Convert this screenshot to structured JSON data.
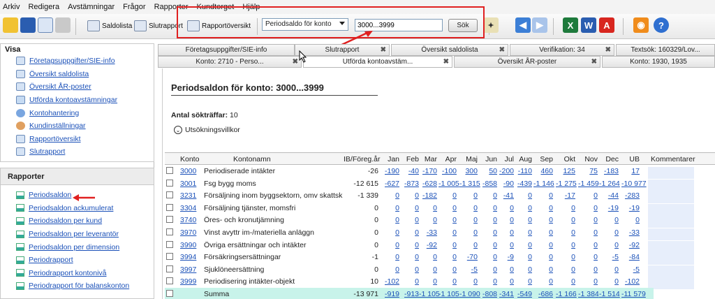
{
  "menu": [
    "Arkiv",
    "Redigera",
    "Avstämningar",
    "Frågor",
    "Rapporter",
    "Kundtorget",
    "Hjälp"
  ],
  "toolbar": {
    "saldolista": "Saldolista",
    "slutrapport": "Slutrapport",
    "rapportoversikt": "Rapportöversikt",
    "report_select": "Periodsaldo för konto",
    "search_value": "3000...3999",
    "search_button": "Sök"
  },
  "visa": {
    "title": "Visa",
    "items": [
      "Företagsuppgifter/SIE-info",
      "Översikt saldolista",
      "Översikt ÅR-poster",
      "Utförda kontoavstämningar",
      "Kontohantering",
      "Kundinställningar",
      "Rapportöversikt",
      "Slutrapport"
    ]
  },
  "rapporter": {
    "title": "Rapporter",
    "items": [
      "Periodsaldon",
      "Periodsaldon ackumulerat",
      "Periodsaldon per kund",
      "Periodsaldon per leverantör",
      "Periodsaldon per dimension",
      "Periodrapport",
      "Periodrapport kontonivå",
      "Periodrapport för balanskonton"
    ]
  },
  "tabs_row1": [
    "Företagsuppgifter/SIE-info",
    "Slutrapport",
    "Översikt saldolista",
    "Verifikation: 34",
    "Textsök: 160329/Lov..."
  ],
  "tabs_row2": [
    "Konto: 2710 - Perso...",
    "Utförda kontoavstäm...",
    "Översikt ÅR-poster",
    "Konto: 1930, 1935"
  ],
  "content": {
    "title": "Periodsaldon för konto: 3000...3999",
    "hits_label": "Antal sökträffar:",
    "hits_value": "10",
    "criteria": "Utsökningsvillkor"
  },
  "table": {
    "headers": [
      "Konto",
      "Kontonamn",
      "IB/Föreg.år",
      "Jan",
      "Feb",
      "Mar",
      "Apr",
      "Maj",
      "Jun",
      "Jul",
      "Aug",
      "Sep",
      "Okt",
      "Nov",
      "Dec",
      "UB",
      "Kommentarer"
    ],
    "rows": [
      [
        "3000",
        "Periodiserade intäkter",
        "-26",
        "-190",
        "-40",
        "-170",
        "-100",
        "300",
        "50",
        "-200",
        "-110",
        "460",
        "125",
        "75",
        "-183",
        "17"
      ],
      [
        "3001",
        "Fsg bygg moms",
        "-12 615",
        "-627",
        "-873",
        "-628",
        "-1 005",
        "-1 315",
        "-858",
        "-90",
        "-439",
        "-1 146",
        "-1 275",
        "-1 459",
        "-1 264",
        "-10 977"
      ],
      [
        "3231",
        "Försäljning inom byggsektorn, omv skattsk",
        "-1 339",
        "0",
        "0",
        "-182",
        "0",
        "0",
        "0",
        "-41",
        "0",
        "0",
        "-17",
        "0",
        "-44",
        "-283"
      ],
      [
        "3304",
        "Försäljning tjänster, momsfri",
        "0",
        "0",
        "0",
        "0",
        "0",
        "0",
        "0",
        "0",
        "0",
        "0",
        "0",
        "0",
        "-19",
        "-19"
      ],
      [
        "3740",
        "Öres- och kronutjämning",
        "0",
        "0",
        "0",
        "0",
        "0",
        "0",
        "0",
        "0",
        "0",
        "0",
        "0",
        "0",
        "0",
        "0"
      ],
      [
        "3970",
        "Vinst avyttr im-/materiella anläggn",
        "0",
        "0",
        "0",
        "-33",
        "0",
        "0",
        "0",
        "0",
        "0",
        "0",
        "0",
        "0",
        "0",
        "-33"
      ],
      [
        "3990",
        "Övriga ersättningar och intäkter",
        "0",
        "0",
        "0",
        "-92",
        "0",
        "0",
        "0",
        "0",
        "0",
        "0",
        "0",
        "0",
        "0",
        "-92"
      ],
      [
        "3994",
        "Försäkringsersättningar",
        "-1",
        "0",
        "0",
        "0",
        "0",
        "-70",
        "0",
        "-9",
        "0",
        "0",
        "0",
        "0",
        "-5",
        "-84"
      ],
      [
        "3997",
        "Sjuklöneersättning",
        "0",
        "0",
        "0",
        "0",
        "0",
        "-5",
        "0",
        "0",
        "0",
        "0",
        "0",
        "0",
        "0",
        "-5"
      ],
      [
        "3999",
        "Periodisering intäkter-objekt",
        "10",
        "-102",
        "0",
        "0",
        "0",
        "0",
        "0",
        "0",
        "0",
        "0",
        "0",
        "0",
        "0",
        "-102"
      ]
    ],
    "sum": [
      "Summa",
      "-13 971",
      "-919",
      "-913",
      "-1 105",
      "-1 105",
      "-1 090",
      "-808",
      "-341",
      "-549",
      "-686",
      "-1 166",
      "-1 384",
      "-1 514",
      "-11 579"
    ]
  },
  "colors": {
    "accent_link": "#1a50b8",
    "highlight_box": "#e02020",
    "sum_row": "#c8f3ea"
  }
}
